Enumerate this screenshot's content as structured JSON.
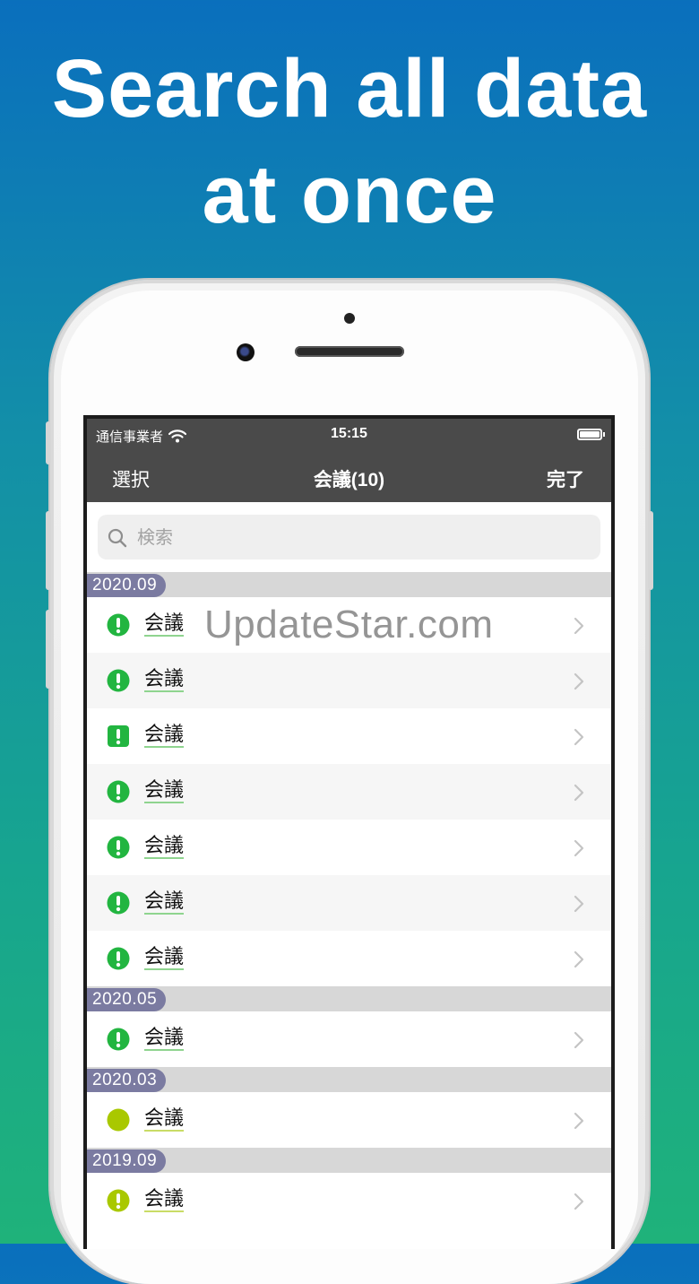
{
  "headline": {
    "line1": "Search all data",
    "line2": "at once"
  },
  "status": {
    "carrier": "通信事業者",
    "time": "15:15"
  },
  "nav": {
    "left": "選択",
    "title": "会議(10)",
    "right": "完了"
  },
  "search": {
    "placeholder": "検索"
  },
  "sections": [
    {
      "date": "2020.09",
      "rows": [
        {
          "label": "会議",
          "icon": "exclamation-circle-green"
        },
        {
          "label": "会議",
          "icon": "exclamation-circle-green"
        },
        {
          "label": "会議",
          "icon": "exclamation-square-green"
        },
        {
          "label": "会議",
          "icon": "exclamation-circle-green"
        },
        {
          "label": "会議",
          "icon": "exclamation-circle-green"
        },
        {
          "label": "会議",
          "icon": "exclamation-circle-green"
        },
        {
          "label": "会議",
          "icon": "exclamation-circle-green"
        }
      ]
    },
    {
      "date": "2020.05",
      "rows": [
        {
          "label": "会議",
          "icon": "exclamation-circle-green"
        }
      ]
    },
    {
      "date": "2020.03",
      "rows": [
        {
          "label": "会議",
          "icon": "circle-lime"
        }
      ]
    },
    {
      "date": "2019.09",
      "rows": [
        {
          "label": "会議",
          "icon": "exclamation-circle-lime"
        }
      ]
    }
  ],
  "watermark": "UpdateStar.com",
  "colors": {
    "green": "#22b540",
    "lime": "#a9c800",
    "section": "#7b7ba1",
    "bar": "#4a4a4a"
  }
}
